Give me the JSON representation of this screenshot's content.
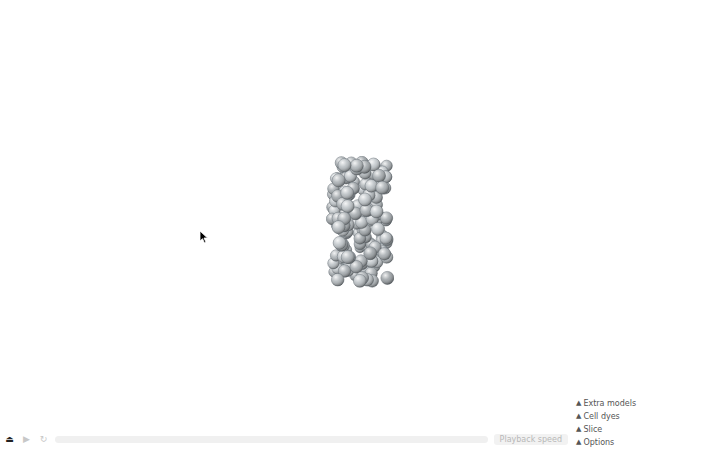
{
  "viewer": {
    "playback": {
      "eject": {
        "icon": "⏏",
        "disabled": false
      },
      "play": {
        "icon": "▶",
        "disabled": true
      },
      "reload": {
        "icon": "↻",
        "disabled": true
      },
      "timeline": {
        "level": 0,
        "disabled": true
      },
      "speed": {
        "label": "Playback speed",
        "disabled": true
      }
    },
    "menus": [
      {
        "icon": "▲",
        "label": "Extra models",
        "expanded": false
      },
      {
        "icon": "▲",
        "label": "Cell dyes",
        "expanded": false
      },
      {
        "icon": "▲",
        "label": "Slice",
        "expanded": false
      },
      {
        "icon": "▲",
        "label": "Options",
        "expanded": false
      }
    ]
  }
}
